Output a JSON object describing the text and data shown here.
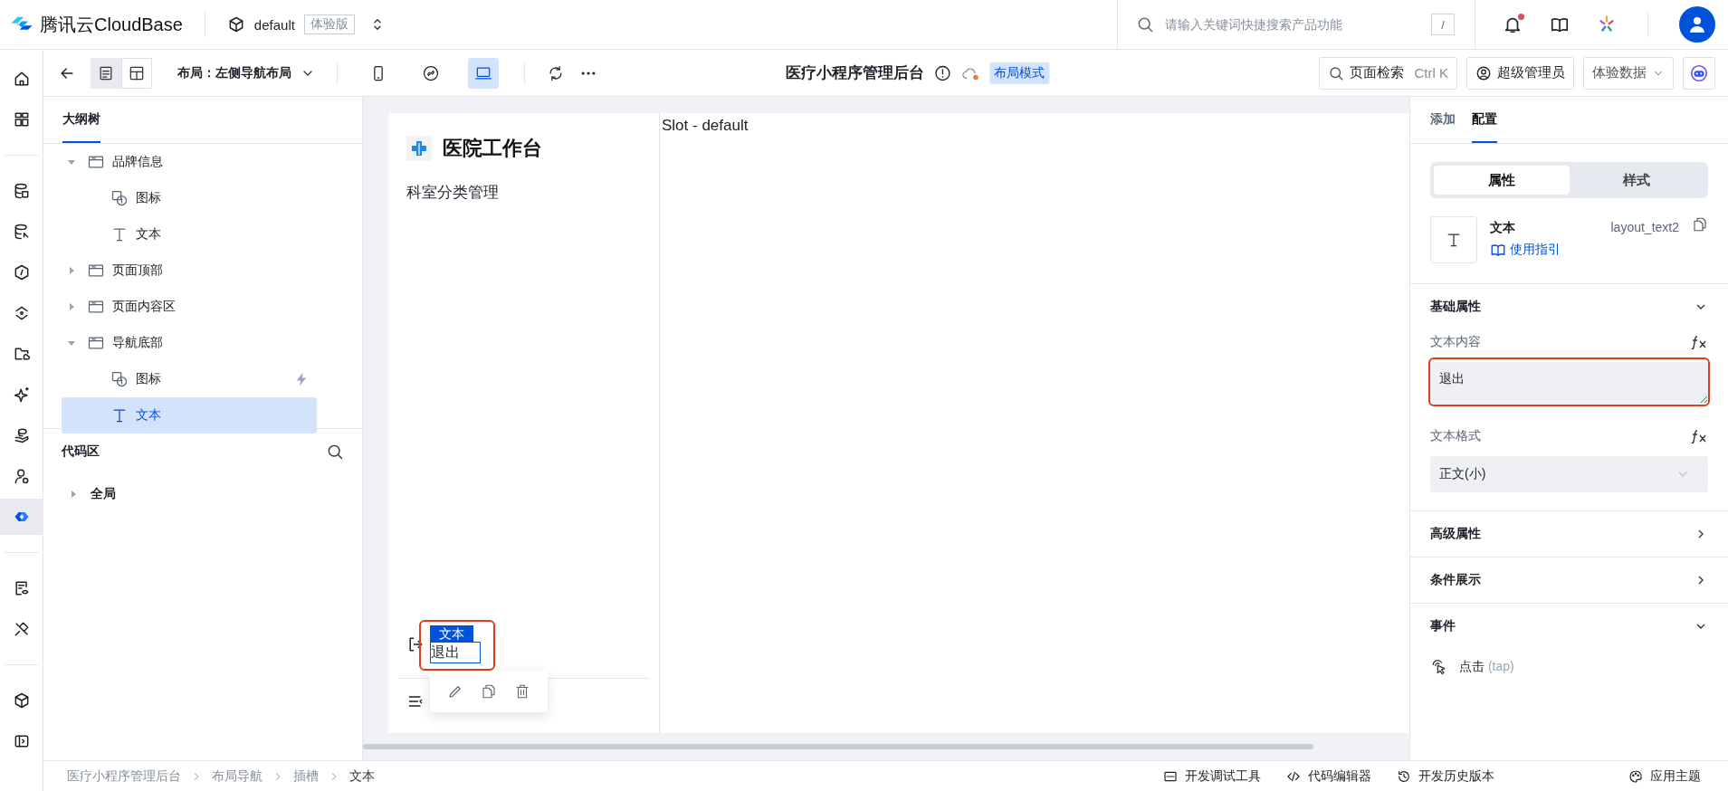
{
  "topbar": {
    "brand": "腾讯云CloudBase",
    "env": "default",
    "env_badge": "体验版",
    "search": {
      "placeholder": "请输入关键词快捷搜索产品功能",
      "shortcut": "/"
    },
    "notification_dot": true
  },
  "rail": [
    [
      {
        "selected": false
      },
      {
        "selected": false
      }
    ],
    [
      {
        "selected": false
      },
      {
        "selected": false
      },
      {
        "selected": false
      },
      {
        "selected": false
      },
      {
        "selected": false
      },
      {
        "selected": false
      },
      {
        "selected": false
      },
      {
        "selected": false
      },
      {
        "selected": true
      }
    ],
    [
      {
        "selected": false
      },
      {
        "selected": false
      }
    ],
    [
      {
        "selected": false
      },
      {
        "selected": false
      }
    ]
  ],
  "toolbar": {
    "views": [
      {
        "selected": true
      },
      {
        "selected": false
      }
    ],
    "layout": "布局：左侧导航布局",
    "devices": [
      {
        "selected": false
      },
      {
        "selected": false
      },
      {
        "selected": true
      }
    ],
    "title": "医疗小程序管理后台",
    "mode_tag": "布局模式",
    "page_search": {
      "label": "页面检索",
      "shortcut": "Ctrl K"
    },
    "role": "超级管理员",
    "data_source": "体验数据"
  },
  "outline": {
    "tabs": [
      {
        "label": "大纲树",
        "selected": true
      }
    ],
    "tree": [
      {
        "label": "品牌信息",
        "kind": "container",
        "expanded": true,
        "selected": false,
        "children": [
          {
            "label": "图标",
            "kind": "icon",
            "selected": false,
            "has_event": false
          },
          {
            "label": "文本",
            "kind": "text",
            "selected": false,
            "has_event": false
          }
        ]
      },
      {
        "label": "页面顶部",
        "kind": "container",
        "expanded": false,
        "selected": false
      },
      {
        "label": "页面内容区",
        "kind": "container",
        "expanded": false,
        "selected": false
      },
      {
        "label": "导航底部",
        "kind": "container",
        "expanded": true,
        "selected": false,
        "children": [
          {
            "label": "图标",
            "kind": "icon",
            "selected": false,
            "has_event": true
          },
          {
            "label": "文本",
            "kind": "text",
            "selected": true,
            "has_event": false
          }
        ]
      }
    ]
  },
  "code_area": {
    "title": "代码区",
    "items": [
      {
        "label": "全局",
        "expanded": false
      }
    ]
  },
  "canvas": {
    "brand": "医院工作台",
    "menu_items": [
      "科室分类管理"
    ],
    "exit_label": "退出",
    "selection_tag": "文本",
    "slot_label": "Slot - default"
  },
  "config": {
    "tabs": [
      {
        "label": "添加",
        "selected": false
      },
      {
        "label": "配置",
        "selected": true
      }
    ],
    "segments": [
      {
        "label": "属性",
        "selected": true
      },
      {
        "label": "样式",
        "selected": false
      }
    ],
    "component": {
      "name": "文本",
      "guide": "使用指引",
      "id": "layout_text2"
    },
    "sections": [
      {
        "title": "基础属性",
        "kind": "fields",
        "expanded": true,
        "fields": [
          {
            "label": "文本内容",
            "kind": "textarea",
            "value": "退出"
          },
          {
            "label": "文本格式",
            "kind": "select",
            "value": "正文(小)"
          }
        ]
      },
      {
        "title": "高级属性",
        "expanded": false
      },
      {
        "title": "条件展示",
        "expanded": false
      },
      {
        "title": "事件",
        "kind": "events",
        "expanded": true,
        "events": [
          {
            "label": "点击",
            "code": "(tap)"
          }
        ]
      }
    ]
  },
  "breadcrumb": [
    "医疗小程序管理后台",
    "布局导航",
    "插槽",
    "文本"
  ],
  "bottom_tools": [
    "开发调试工具",
    "代码编辑器",
    "开发历史版本",
    "应用主题"
  ]
}
